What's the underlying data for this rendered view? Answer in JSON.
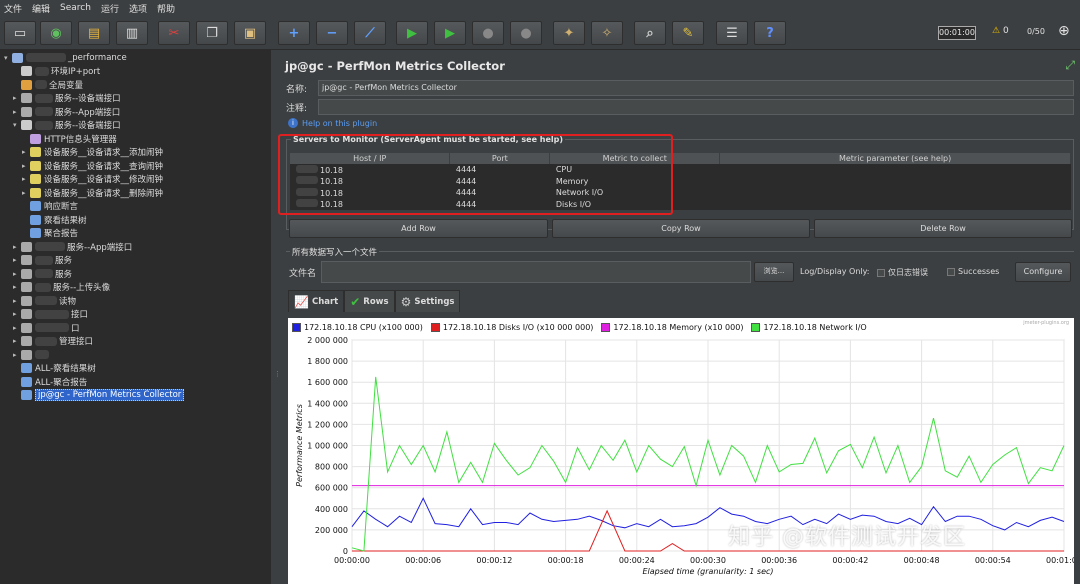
{
  "menu": [
    "文件",
    "编辑",
    "Search",
    "运行",
    "选项",
    "帮助"
  ],
  "toolbar": {
    "icons": [
      "new-icon",
      "templates-icon",
      "open-icon",
      "save-icon",
      "cut-icon",
      "copy-icon",
      "paste-icon",
      "expand-icon",
      "collapse-icon",
      "toggle-icon",
      "start-icon",
      "start-no-pause-icon",
      "stop-icon",
      "shutdown-icon",
      "clear-icon",
      "clear-all-icon",
      "search-icon",
      "reset-search-icon",
      "function-helper-icon",
      "help-icon"
    ],
    "timer": "00:01:00",
    "warnings": "0",
    "threads": "0/50"
  },
  "tree": [
    {
      "label": "_performance",
      "indent": 0,
      "tog": "▾",
      "color": "#8fb0e0",
      "blur": 40
    },
    {
      "label": "环境IP+port",
      "indent": 1,
      "tog": "",
      "color": "#cccccc",
      "blur": 14
    },
    {
      "label": "全局变量",
      "indent": 1,
      "tog": "",
      "color": "#e0a040",
      "blur": 12
    },
    {
      "label": "服务--设备端接口",
      "indent": 1,
      "tog": "▸",
      "color": "#aaaaaa",
      "blur": 18
    },
    {
      "label": "服务--App端接口",
      "indent": 1,
      "tog": "▸",
      "color": "#aaaaaa",
      "blur": 18
    },
    {
      "label": "服务--设备端接口",
      "indent": 1,
      "tog": "▾",
      "color": "#cccccc",
      "blur": 18
    },
    {
      "label": "HTTP信息头管理器",
      "indent": 2,
      "tog": "",
      "color": "#c0a0e0",
      "blur": 0
    },
    {
      "label": "设备服务__设备请求__添加闹钟",
      "indent": 2,
      "tog": "▸",
      "color": "#e0d060",
      "blur": 0
    },
    {
      "label": "设备服务__设备请求__查询闹钟",
      "indent": 2,
      "tog": "▸",
      "color": "#e0d060",
      "blur": 0
    },
    {
      "label": "设备服务__设备请求__修改闹钟",
      "indent": 2,
      "tog": "▸",
      "color": "#e0d060",
      "blur": 0
    },
    {
      "label": "设备服务__设备请求__删除闹钟",
      "indent": 2,
      "tog": "▸",
      "color": "#e0d060",
      "blur": 0
    },
    {
      "label": "响应断言",
      "indent": 2,
      "tog": "",
      "color": "#70a0e0",
      "blur": 0
    },
    {
      "label": "察看结果树",
      "indent": 2,
      "tog": "",
      "color": "#70a0e0",
      "blur": 0
    },
    {
      "label": "聚合报告",
      "indent": 2,
      "tog": "",
      "color": "#70a0e0",
      "blur": 0
    },
    {
      "label": "服务--App端接口",
      "indent": 1,
      "tog": "▸",
      "color": "#aaaaaa",
      "blur": 30
    },
    {
      "label": "服务",
      "indent": 1,
      "tog": "▸",
      "color": "#aaaaaa",
      "blur": 18
    },
    {
      "label": "服务",
      "indent": 1,
      "tog": "▸",
      "color": "#aaaaaa",
      "blur": 18
    },
    {
      "label": "服务--上传头像",
      "indent": 1,
      "tog": "▸",
      "color": "#aaaaaa",
      "blur": 16
    },
    {
      "label": "读物",
      "indent": 1,
      "tog": "▸",
      "color": "#aaaaaa",
      "blur": 22
    },
    {
      "label": "接口",
      "indent": 1,
      "tog": "▸",
      "color": "#aaaaaa",
      "blur": 34
    },
    {
      "label": "口",
      "indent": 1,
      "tog": "▸",
      "color": "#aaaaaa",
      "blur": 34
    },
    {
      "label": "管理接口",
      "indent": 1,
      "tog": "▸",
      "color": "#aaaaaa",
      "blur": 22
    },
    {
      "label": "",
      "indent": 1,
      "tog": "▸",
      "color": "#aaaaaa",
      "blur": 14
    },
    {
      "label": "ALL-察看结果树",
      "indent": 1,
      "tog": "",
      "color": "#70a0e0",
      "blur": 0
    },
    {
      "label": "ALL-聚合报告",
      "indent": 1,
      "tog": "",
      "color": "#70a0e0",
      "blur": 0
    },
    {
      "label": "jp@gc - PerfMon Metrics Collector",
      "indent": 1,
      "tog": "",
      "color": "#70a0e0",
      "blur": 0,
      "selected": true
    }
  ],
  "panel": {
    "title": "jp@gc - PerfMon Metrics Collector",
    "name_label": "名称:",
    "name_value": "jp@gc - PerfMon Metrics Collector",
    "comment_label": "注释:",
    "help_link": "Help on this plugin",
    "servers_title": "Servers to Monitor (ServerAgent must be started, see help)",
    "columns": [
      "Host / IP",
      "Port",
      "Metric to collect",
      "Metric parameter (see help)"
    ],
    "rows": [
      {
        "host": "10.18",
        "port": "4444",
        "metric": "CPU",
        "param": ""
      },
      {
        "host": "10.18",
        "port": "4444",
        "metric": "Memory",
        "param": ""
      },
      {
        "host": "10.18",
        "port": "4444",
        "metric": "Network I/O",
        "param": ""
      },
      {
        "host": "10.18",
        "port": "4444",
        "metric": "Disks I/O",
        "param": ""
      }
    ],
    "add_row": "Add Row",
    "copy_row": "Copy Row",
    "delete_row": "Delete Row",
    "file_title": "所有数据写入一个文件",
    "file_label": "文件名",
    "browse": "浏览...",
    "log_display": "Log/Display Only:",
    "errors_only": "仅日志错误",
    "successes": "Successes",
    "configure": "Configure",
    "tabs": [
      {
        "label": "Chart",
        "icon": "chart-icon"
      },
      {
        "label": "Rows",
        "icon": "check-icon"
      },
      {
        "label": "Settings",
        "icon": "gear-icon"
      }
    ]
  },
  "chart_data": {
    "type": "line",
    "watermark_small": "jmeter-plugins.org",
    "ylabel": "Performance Metrics",
    "xlabel": "Elapsed time (granularity: 1 sec)",
    "ylim": [
      0,
      2000000
    ],
    "yticks": [
      "0",
      "200 000",
      "400 000",
      "600 000",
      "800 000",
      "1 000 000",
      "1 200 000",
      "1 400 000",
      "1 600 000",
      "1 800 000",
      "2 000 000"
    ],
    "xticks": [
      "00:00:00",
      "00:00:06",
      "00:00:12",
      "00:00:18",
      "00:00:24",
      "00:00:30",
      "00:00:36",
      "00:00:42",
      "00:00:48",
      "00:00:54",
      "00:01:00"
    ],
    "xlim": [
      0,
      60
    ],
    "series": [
      {
        "name": "172.18.10.18 CPU (x100 000)",
        "color": "#2020e0",
        "values": [
          230000,
          380000,
          300000,
          230000,
          330000,
          270000,
          500000,
          260000,
          250000,
          230000,
          400000,
          250000,
          270000,
          270000,
          250000,
          360000,
          300000,
          280000,
          290000,
          300000,
          330000,
          290000,
          240000,
          220000,
          260000,
          230000,
          300000,
          230000,
          240000,
          260000,
          320000,
          410000,
          350000,
          330000,
          280000,
          260000,
          300000,
          330000,
          250000,
          300000,
          260000,
          350000,
          300000,
          340000,
          330000,
          280000,
          260000,
          310000,
          250000,
          420000,
          280000,
          330000,
          330000,
          300000,
          240000,
          200000,
          270000,
          230000,
          290000,
          320000,
          280000
        ]
      },
      {
        "name": "172.18.10.18 Disks I/O (x10 000 000)",
        "color": "#e02020",
        "values": [
          0,
          0,
          0,
          0,
          0,
          0,
          0,
          0,
          0,
          0,
          0,
          0,
          0,
          0,
          0,
          0,
          0,
          0,
          0,
          0,
          0,
          0,
          0,
          0,
          0,
          0,
          0,
          0,
          0,
          0,
          0,
          0,
          0,
          0,
          0,
          0,
          0,
          0,
          0,
          0,
          0,
          0,
          0,
          0,
          0,
          0,
          0,
          0,
          0,
          0,
          0,
          0,
          0,
          0,
          0,
          0,
          0,
          0,
          0,
          0,
          0
        ],
        "spikes": [
          [
            20,
            0
          ],
          [
            21.5,
            380000
          ],
          [
            23,
            0
          ],
          [
            26,
            0
          ],
          [
            27,
            70000
          ],
          [
            28,
            0
          ]
        ]
      },
      {
        "name": "172.18.10.18 Memory (x10 000)",
        "color": "#e020e0",
        "values": [
          620000,
          620000,
          620000,
          620000,
          620000,
          620000,
          620000,
          620000,
          620000,
          620000,
          620000,
          620000,
          620000,
          620000,
          620000,
          620000,
          620000,
          620000,
          620000,
          620000,
          620000,
          620000,
          620000,
          620000,
          620000,
          620000,
          620000,
          620000,
          620000,
          620000,
          620000,
          620000,
          620000,
          620000,
          620000,
          620000,
          620000,
          620000,
          620000,
          620000,
          620000,
          620000,
          620000,
          620000,
          620000,
          620000,
          620000,
          620000,
          620000,
          620000,
          620000,
          620000,
          620000,
          620000,
          620000,
          620000,
          620000,
          620000,
          620000,
          620000,
          620000
        ]
      },
      {
        "name": "172.18.10.18 Network I/O",
        "color": "#40e040",
        "values": [
          30000,
          0,
          1650000,
          750000,
          1000000,
          820000,
          1000000,
          750000,
          1130000,
          650000,
          840000,
          650000,
          1020000,
          860000,
          720000,
          790000,
          1000000,
          850000,
          650000,
          980000,
          770000,
          1000000,
          860000,
          1050000,
          750000,
          1000000,
          870000,
          800000,
          990000,
          620000,
          1050000,
          720000,
          1000000,
          900000,
          650000,
          1000000,
          750000,
          820000,
          830000,
          1070000,
          740000,
          950000,
          1010000,
          790000,
          1080000,
          740000,
          1000000,
          650000,
          800000,
          1260000,
          760000,
          700000,
          900000,
          650000,
          820000,
          910000,
          980000,
          640000,
          790000,
          760000,
          1000000
        ]
      }
    ]
  }
}
